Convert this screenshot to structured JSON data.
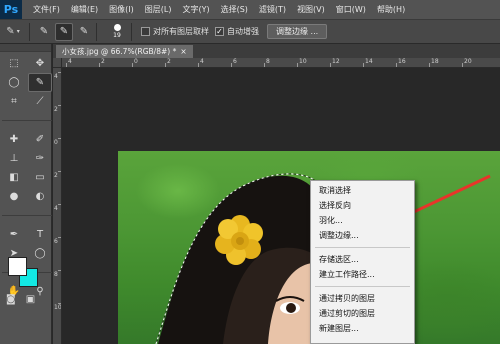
{
  "app": {
    "logo": "Ps"
  },
  "menubar": {
    "items": [
      "文件(F)",
      "编辑(E)",
      "图像(I)",
      "图层(L)",
      "文字(Y)",
      "选择(S)",
      "滤镜(T)",
      "视图(V)",
      "窗口(W)",
      "帮助(H)"
    ]
  },
  "options": {
    "brush_size": "19",
    "sample_all_layers_label": "对所有图层取样",
    "sample_all_layers_checked": false,
    "auto_enhance_label": "自动增强",
    "auto_enhance_checked": true,
    "refine_edge_label": "调整边缘 ...",
    "checkmark": "✓"
  },
  "document": {
    "tab_label": "小女孩.jpg @ 66.7%(RGB/8#) *",
    "close": "×"
  },
  "rulers": {
    "h_ticks": [
      "4",
      "2",
      "0",
      "2",
      "4",
      "6",
      "8",
      "10",
      "12",
      "14",
      "16",
      "18",
      "20",
      "22"
    ],
    "v_ticks": [
      "4",
      "2",
      "0",
      "2",
      "4",
      "6",
      "8",
      "10"
    ]
  },
  "colors": {
    "foreground": "#ffffff",
    "background": "#13e8e3",
    "arrow": "#e8342a"
  },
  "context_menu": {
    "groups": [
      [
        "取消选择",
        "选择反向",
        "羽化...",
        "调整边缘..."
      ],
      [
        "存储选区...",
        "建立工作路径..."
      ],
      [
        "通过拷贝的图层",
        "通过剪切的图层",
        "新建图层..."
      ]
    ]
  }
}
